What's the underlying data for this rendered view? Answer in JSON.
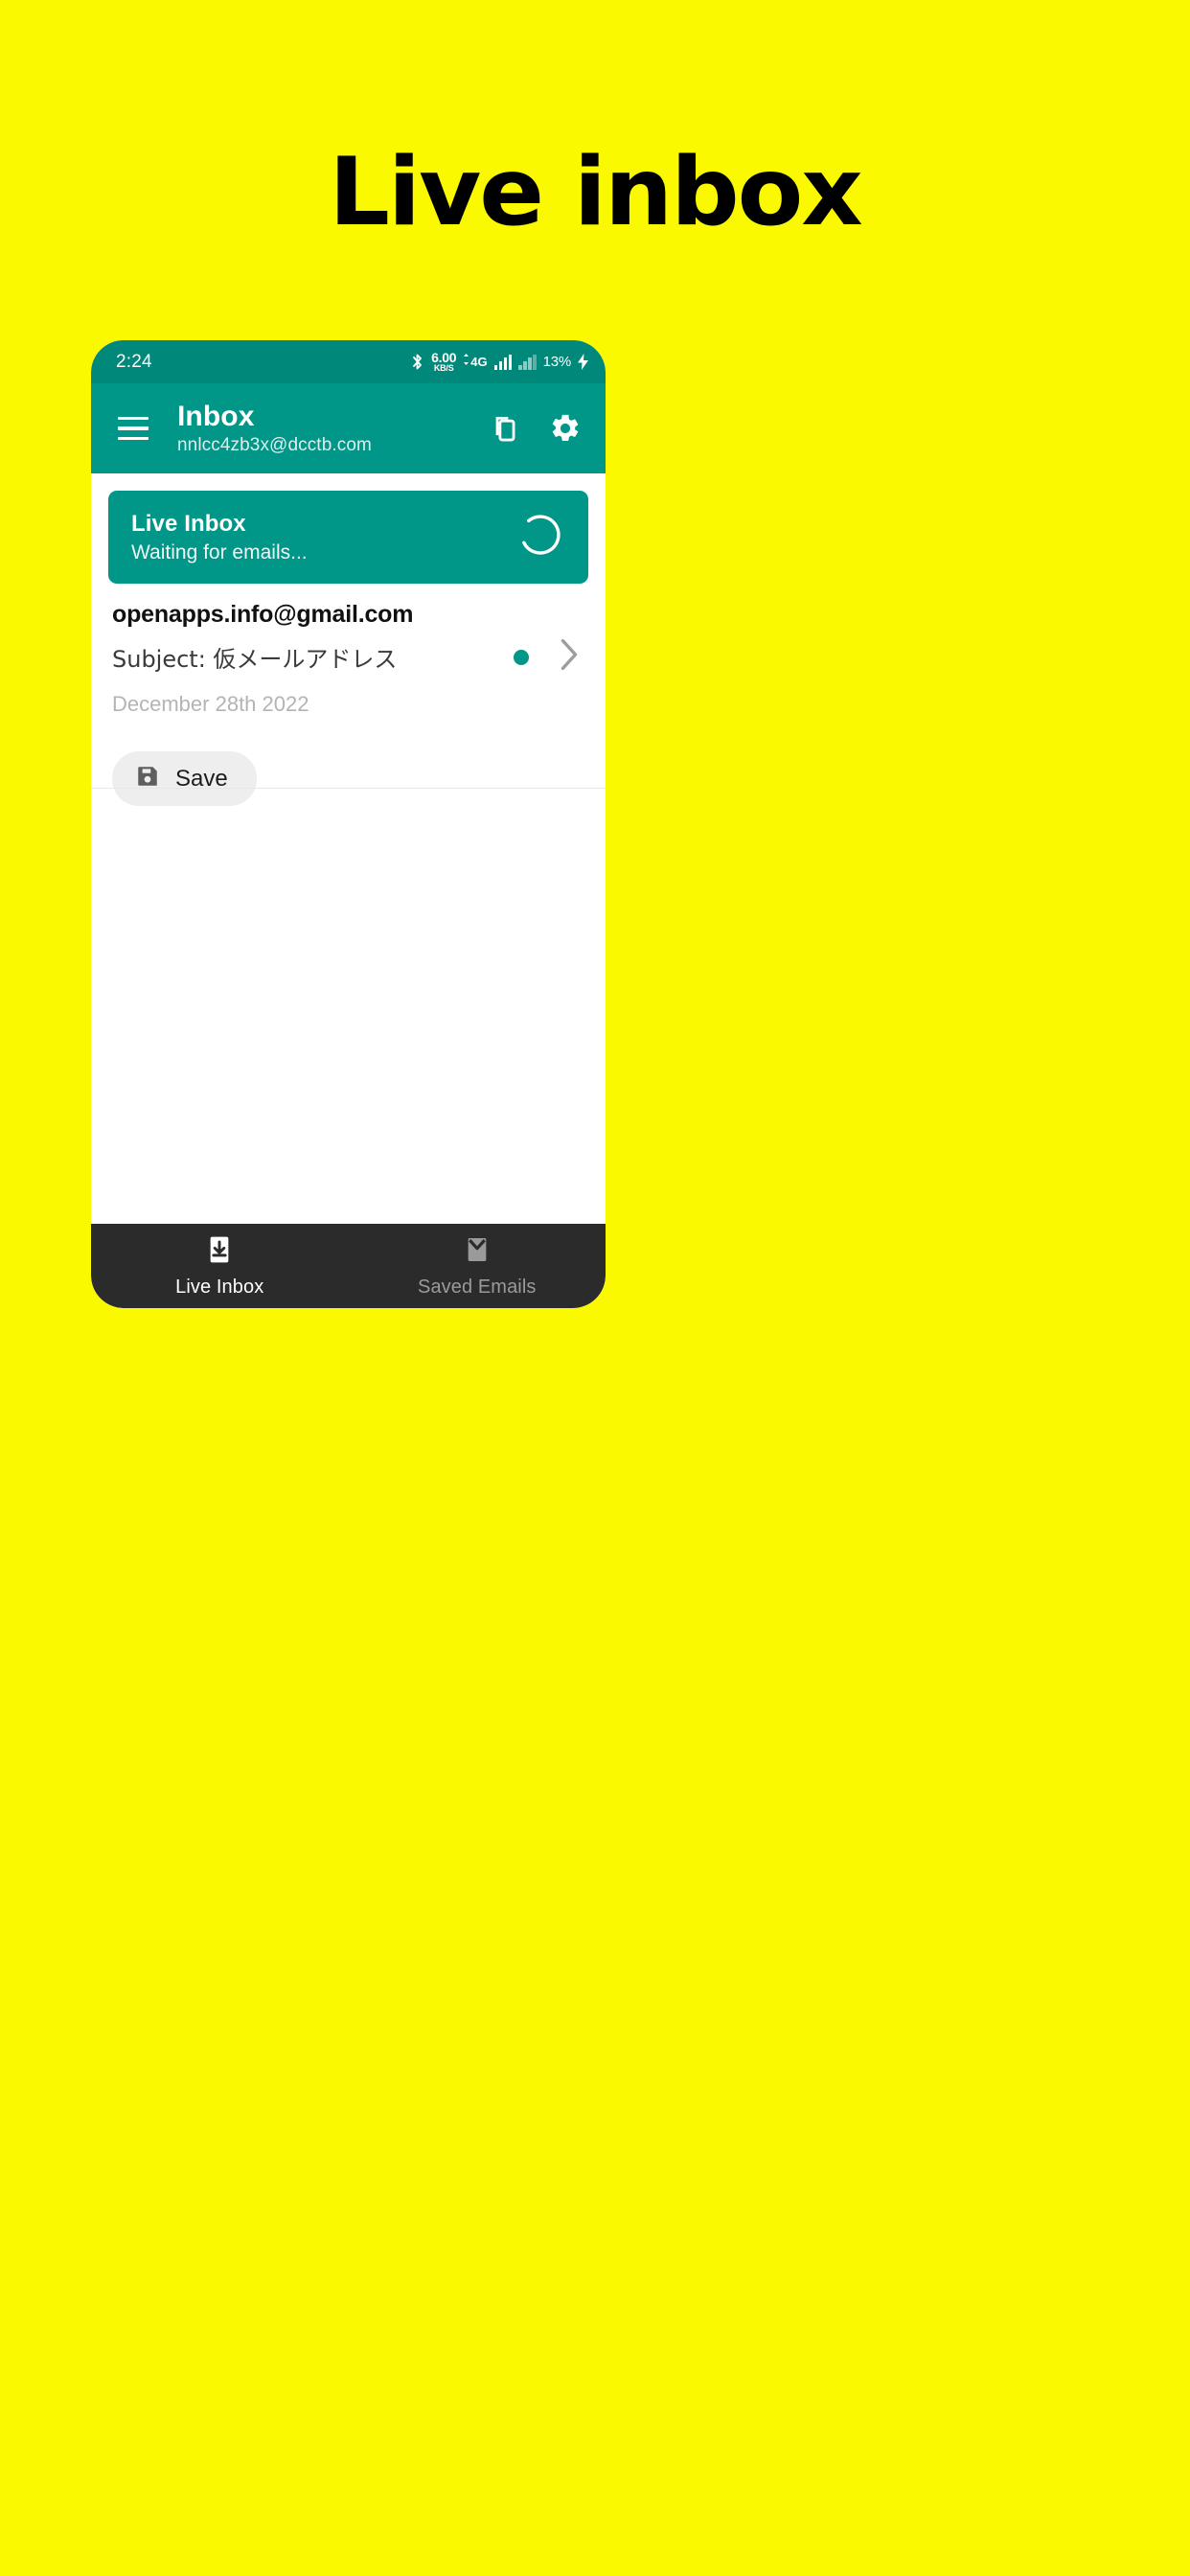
{
  "promo": {
    "headline": "Live inbox"
  },
  "colors": {
    "background": "#FAF900",
    "teal": "#009688",
    "teal_dark": "#00897B",
    "nav_bar": "#2b2b2b",
    "accent_dot": "#009688"
  },
  "statusbar": {
    "time": "2:24",
    "bluetooth_icon": "bluetooth-icon",
    "net_speed_value": "6.00",
    "net_speed_unit": "KB/S",
    "network_type": "4G",
    "data_arrows_icon": "data-transfer-arrows-icon",
    "signal_icon_1": "signal-bars-icon",
    "signal_icon_2": "signal-bars-icon",
    "battery": "13%",
    "charging_icon": "charging-bolt-icon"
  },
  "appbar": {
    "menu_icon": "hamburger-menu-icon",
    "title": "Inbox",
    "subtitle": "nnlcc4zb3x@dcctb.com",
    "copy_icon": "copy-icon",
    "settings_icon": "gear-icon"
  },
  "live_card": {
    "title": "Live Inbox",
    "status": "Waiting for emails...",
    "spinner_icon": "loading-spinner-icon"
  },
  "email": {
    "from": "openapps.info@gmail.com",
    "subject": "Subject: 仮メールアドレス",
    "unread_dot": "unread-dot",
    "chevron_icon": "chevron-right-icon",
    "date": "December 28th 2022",
    "save_label": "Save",
    "save_icon": "floppy-disk-save-icon"
  },
  "bottom_nav": {
    "items": [
      {
        "label": "Live Inbox",
        "icon": "inbox-download-icon",
        "active": true
      },
      {
        "label": "Saved Emails",
        "icon": "envelope-icon",
        "active": false
      }
    ]
  }
}
